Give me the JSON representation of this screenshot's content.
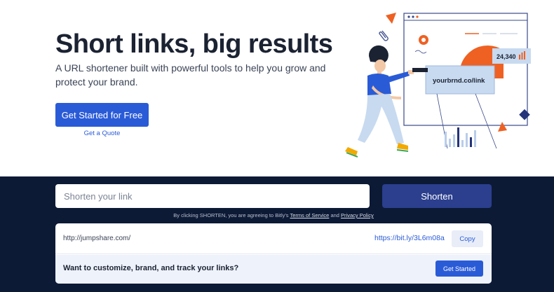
{
  "hero": {
    "headline": "Short links, big results",
    "subline": "A URL shortener built with powerful tools to help you grow and protect your brand.",
    "primary_cta": "Get Started for Free",
    "secondary_cta": "Get a Quote"
  },
  "illustration": {
    "stat_value": "24,340",
    "link_label": "yourbrnd.co/link",
    "icons": [
      "paperclip-icon",
      "bar-chart-icon",
      "person-illustration"
    ]
  },
  "shortener": {
    "input_placeholder": "Shorten your link",
    "shorten_button": "Shorten",
    "terms_prefix": "By clicking SHORTEN, you are agreeing to Bitly's ",
    "terms_link": "Terms of Service",
    "terms_and": " and ",
    "privacy_link": "Privacy Policy"
  },
  "result": {
    "original_url": "http://jumpshare.com/",
    "short_url": "https://bit.ly/3L6m08a",
    "copy_button": "Copy"
  },
  "promo": {
    "text": "Want to customize, brand, and track your links?",
    "button": "Get Started"
  },
  "colors": {
    "accent": "#2a5bd7",
    "panel_bg": "#0d1a36",
    "shorten_button": "#2b3f8e",
    "illustration_orange": "#ee6123",
    "illustration_navy": "#24337a"
  }
}
